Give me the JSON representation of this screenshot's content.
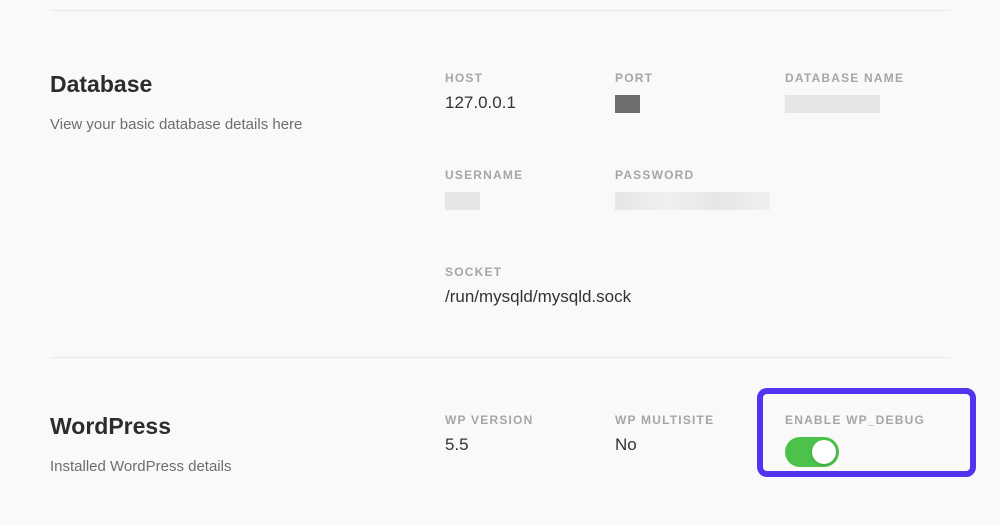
{
  "database": {
    "title": "Database",
    "subtitle": "View your basic database details here",
    "fields": {
      "host": {
        "label": "HOST",
        "value": "127.0.0.1"
      },
      "port": {
        "label": "PORT"
      },
      "database_name": {
        "label": "DATABASE NAME"
      },
      "username": {
        "label": "USERNAME"
      },
      "password": {
        "label": "PASSWORD"
      },
      "socket": {
        "label": "SOCKET",
        "value": "/run/mysqld/mysqld.sock"
      }
    }
  },
  "wordpress": {
    "title": "WordPress",
    "subtitle": "Installed WordPress details",
    "fields": {
      "wp_version": {
        "label": "WP VERSION",
        "value": "5.5"
      },
      "wp_multisite": {
        "label": "WP MULTISITE",
        "value": "No"
      },
      "enable_wp_debug": {
        "label": "ENABLE WP_DEBUG",
        "enabled": true
      }
    }
  }
}
